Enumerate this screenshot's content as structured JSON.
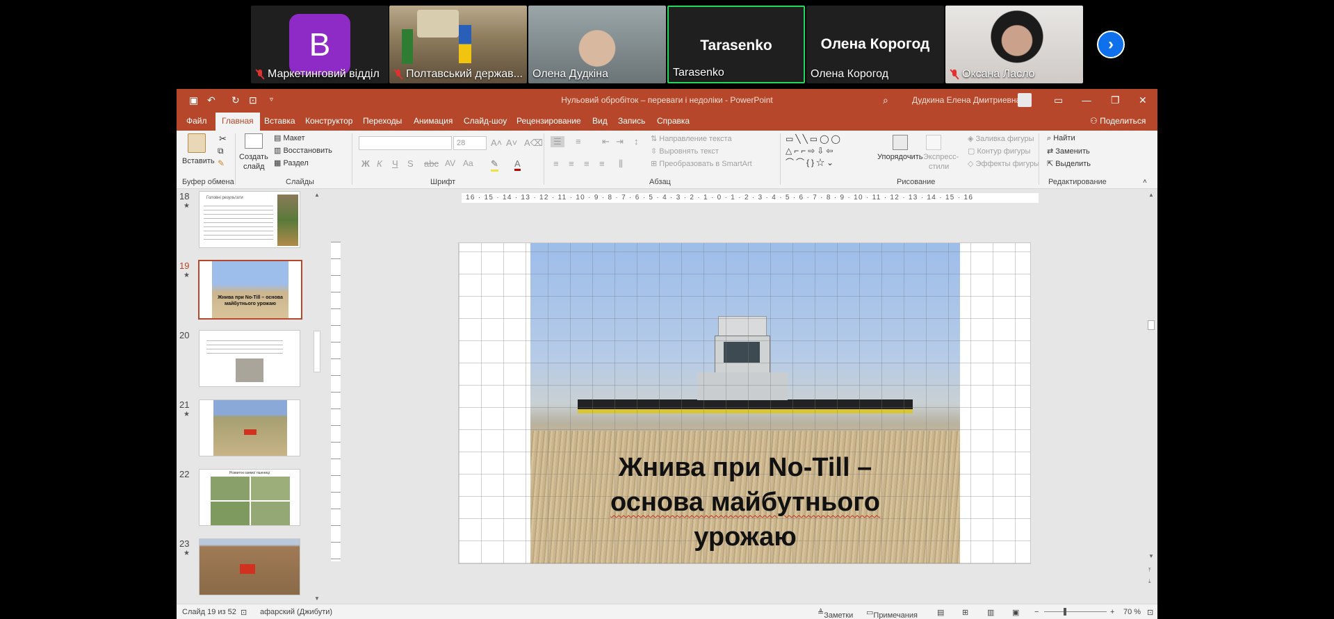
{
  "participants": [
    {
      "name": "Маркетинговий відділ",
      "avatar_letter": "B",
      "muted": true
    },
    {
      "name": "Полтавський держав...",
      "muted": true
    },
    {
      "name": "Олена Дудкіна",
      "muted": false
    },
    {
      "name": "Tarasenko",
      "big": "Tarasenko",
      "muted": false,
      "active": true
    },
    {
      "name": "Олена Корогод",
      "big": "Олена Корогод",
      "muted": false
    },
    {
      "name": "Оксана Ласло",
      "muted": true
    }
  ],
  "next_arrow": "›",
  "window": {
    "title": "Нульовий обробіток – переваги і недоліки  -  PowerPoint",
    "user": "Дудкина Елена Дмитриевна"
  },
  "menu": [
    "Файл",
    "Главная",
    "Вставка",
    "Конструктор",
    "Переходы",
    "Анимация",
    "Слайд-шоу",
    "Рецензирование",
    "Вид",
    "Запись",
    "Справка"
  ],
  "share": "Поделиться",
  "ribbon": {
    "paste": "Вставить",
    "clipboard": "Буфер обмена",
    "new_slide_1": "Создать",
    "new_slide_2": "слайд",
    "layout": "Макет",
    "reset": "Восстановить",
    "section": "Раздел",
    "slides": "Слайды",
    "font_size": "28",
    "font_group": "Шрифт",
    "paragraph": "Абзац",
    "text_dir": "Направление текста",
    "align_text": "Выровнять текст",
    "smartart": "Преобразовать в SmartArt",
    "arrange": "Упорядочить",
    "quick_styles_1": "Экспресс-",
    "quick_styles_2": "стили",
    "shape_fill": "Заливка фигуры",
    "shape_outline": "Контур фигуры",
    "shape_effects": "Эффекты фигуры",
    "drawing": "Рисование",
    "find": "Найти",
    "replace": "Заменить",
    "select": "Выделить",
    "editing": "Редактирование"
  },
  "thumbnails": [
    {
      "num": "18",
      "title": "Головні результати"
    },
    {
      "num": "19",
      "caption": "Жнива при No-Till – основа майбутнього урожаю"
    },
    {
      "num": "20"
    },
    {
      "num": "21"
    },
    {
      "num": "22",
      "title": "Розвиток озимої пшениці"
    },
    {
      "num": "23"
    }
  ],
  "ruler_h": "16 · 15 · 14 · 13 · 12 · 11 · 10 · 9 · 8 · 7 · 6 · 5 · 4 · 3 · 2 · 1 · 0 · 1 · 2 · 3 · 4 · 5 · 6 · 7 · 8 · 9 · 10 · 11 · 12 · 13 · 14 · 15 · 16",
  "slide": {
    "title_line1": "Жнива при No-Till –",
    "title_line2": "основа майбутнього",
    "title_line3": "урожаю"
  },
  "status": {
    "slide_counter": "Слайд 19 из 52",
    "language": "афарский (Джибути)",
    "notes": "Заметки",
    "comments": "Примечания",
    "zoom": "70 %"
  }
}
